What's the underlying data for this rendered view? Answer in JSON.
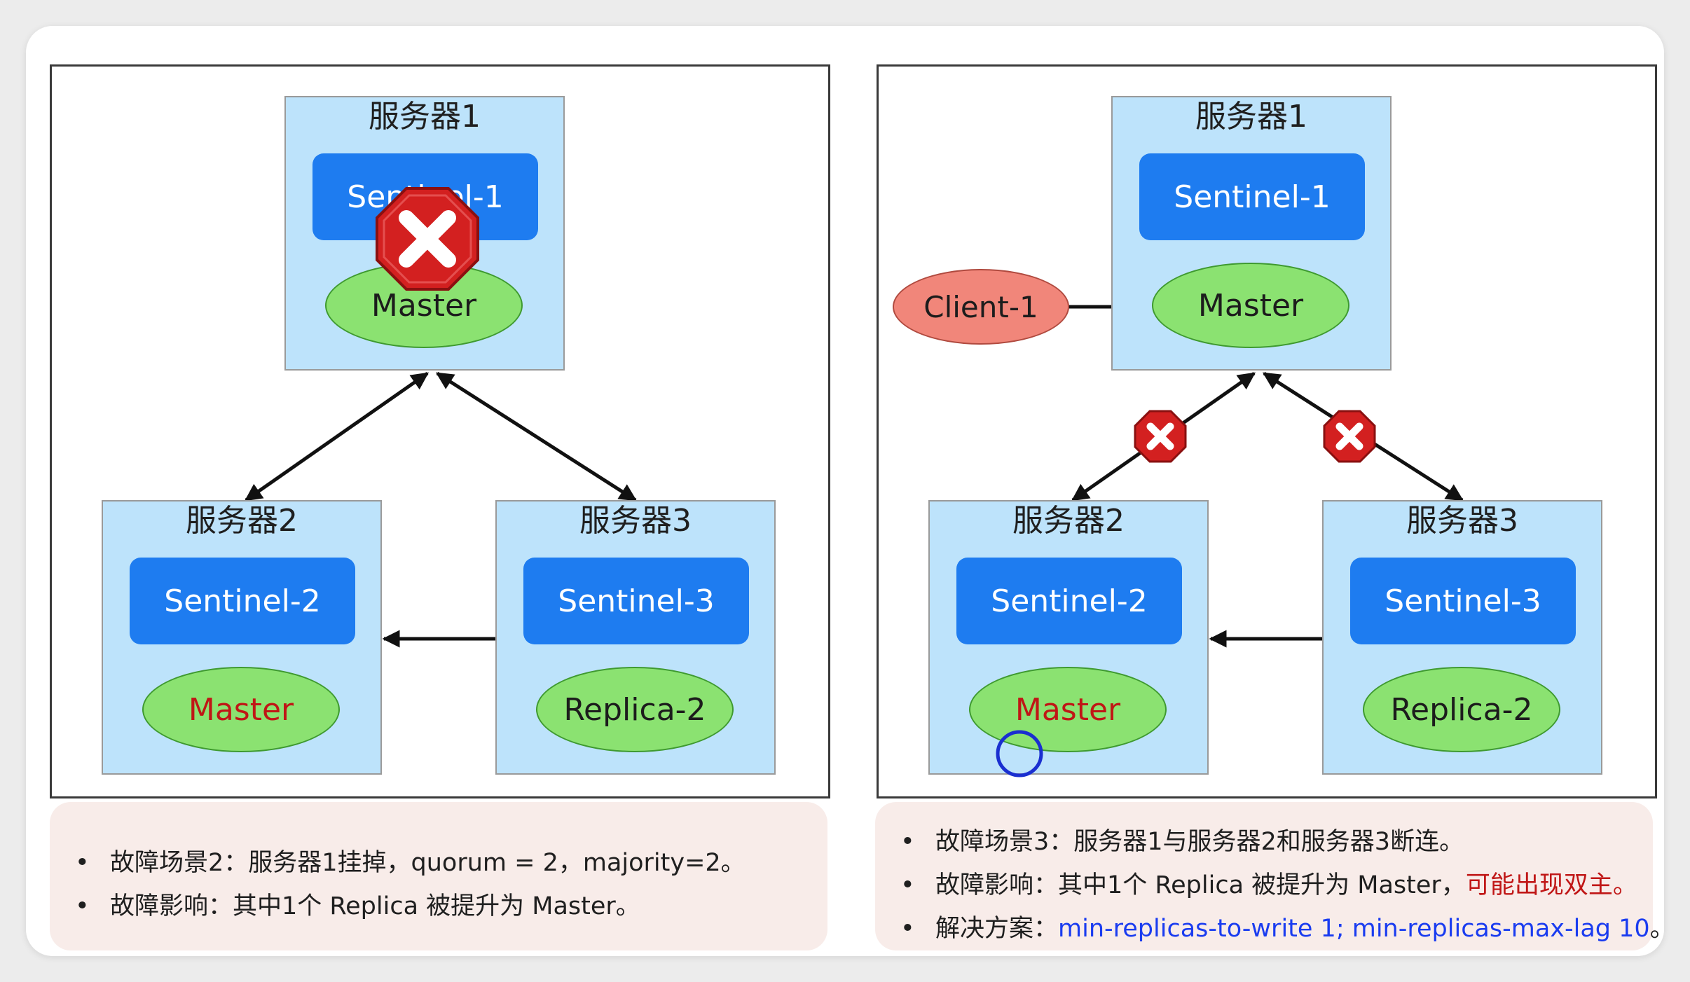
{
  "left_panel": {
    "server1": {
      "title": "服务器1",
      "sentinel": "Sentinel-1",
      "node": "Master"
    },
    "server2": {
      "title": "服务器2",
      "sentinel": "Sentinel-2",
      "node": "Master"
    },
    "server3": {
      "title": "服务器3",
      "sentinel": "Sentinel-3",
      "node": "Replica-2"
    }
  },
  "right_panel": {
    "client": "Client-1",
    "server1": {
      "title": "服务器1",
      "sentinel": "Sentinel-1",
      "node": "Master"
    },
    "server2": {
      "title": "服务器2",
      "sentinel": "Sentinel-2",
      "node": "Master"
    },
    "server3": {
      "title": "服务器3",
      "sentinel": "Sentinel-3",
      "node": "Replica-2"
    }
  },
  "notes_left": [
    "故障场景2：服务器1挂掉，quorum = 2，majority=2。",
    "故障影响：其中1个 Replica 被提升为 Master。"
  ],
  "notes_right": {
    "line1": "故障场景3：服务器1与服务器2和服务器3断连。",
    "line2_prefix": "故障影响：其中1个 Replica 被提升为 Master，",
    "line2_highlight": "可能出现双主。",
    "line3_prefix": "解决方案：",
    "line3_highlight": "min-replicas-to-write 1; min-replicas-max-lag 10",
    "line3_suffix": "。"
  },
  "colors": {
    "server_box": "#bde3fb",
    "sentinel_box": "#1e7cf0",
    "node_green": "#8be271",
    "client_red": "#f1867a",
    "fault_icon": "#d32020",
    "highlight_red": "#c01616",
    "highlight_blue": "#1a3cf0"
  },
  "icons": {
    "fault": "red-octagon-x-icon",
    "cursor": "blue-circle-marker"
  }
}
